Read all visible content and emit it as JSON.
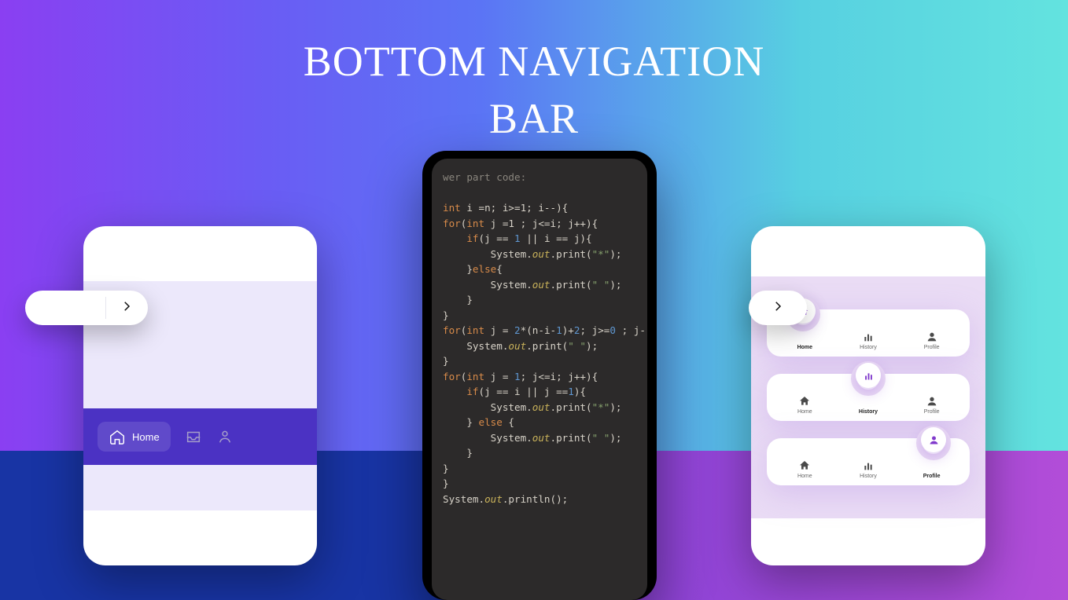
{
  "title": {
    "line1": "BOTTOM NAVIGATION",
    "line2": "BAR"
  },
  "left_card": {
    "active_label": "Home",
    "icons": [
      "home-icon",
      "inbox-icon",
      "user-icon"
    ]
  },
  "right_card": {
    "labels": {
      "home": "Home",
      "history": "History",
      "profile": "Profile"
    }
  },
  "code": {
    "header": "wer part code:",
    "l1_a": "int",
    "l1_b": " i =n; i>=1; i--){",
    "l2_a": "for",
    "l2_b": "(",
    "l2_c": "int",
    "l2_d": " j =1 ; j<=i; j++){",
    "l3_a": "    ",
    "l3_b": "if",
    "l3_c": "(j == ",
    "l3_d": "1",
    "l3_e": " || i == j){",
    "l4_a": "        System.",
    "l4_b": "out",
    "l4_c": ".print(",
    "l4_d": "\"*\"",
    "l4_e": ");",
    "l5_a": "    }",
    "l5_b": "else",
    "l5_c": "{",
    "l6_a": "        System.",
    "l6_b": "out",
    "l6_c": ".print(",
    "l6_d": "\" \"",
    "l6_e": ");",
    "l7": "    }",
    "l8": "}",
    "l9_a": "for",
    "l9_b": "(",
    "l9_c": "int",
    "l9_d": " j = ",
    "l9_e": "2",
    "l9_f": "*(n-i-",
    "l9_g": "1",
    "l9_h": ")+",
    "l9_i": "2",
    "l9_j": "; j>=",
    "l9_k": "0",
    "l9_l": " ; j--)",
    "l10_a": "    System.",
    "l10_b": "out",
    "l10_c": ".print(",
    "l10_d": "\" \"",
    "l10_e": ");",
    "l11": "}",
    "l12_a": "for",
    "l12_b": "(",
    "l12_c": "int",
    "l12_d": " j = ",
    "l12_e": "1",
    "l12_f": "; j<=i; j++){",
    "l13_a": "    ",
    "l13_b": "if",
    "l13_c": "(j == i || j ==",
    "l13_d": "1",
    "l13_e": "){",
    "l14_a": "        System.",
    "l14_b": "out",
    "l14_c": ".print(",
    "l14_d": "\"*\"",
    "l14_e": ");",
    "l15_a": "    } ",
    "l15_b": "else",
    "l15_c": " {",
    "l16_a": "        System.",
    "l16_b": "out",
    "l16_c": ".print(",
    "l16_d": "\" \"",
    "l16_e": ");",
    "l17": "    }",
    "l18": "}",
    "l19": "}",
    "l20_a": "System.",
    "l20_b": "out",
    "l20_c": ".println();"
  }
}
